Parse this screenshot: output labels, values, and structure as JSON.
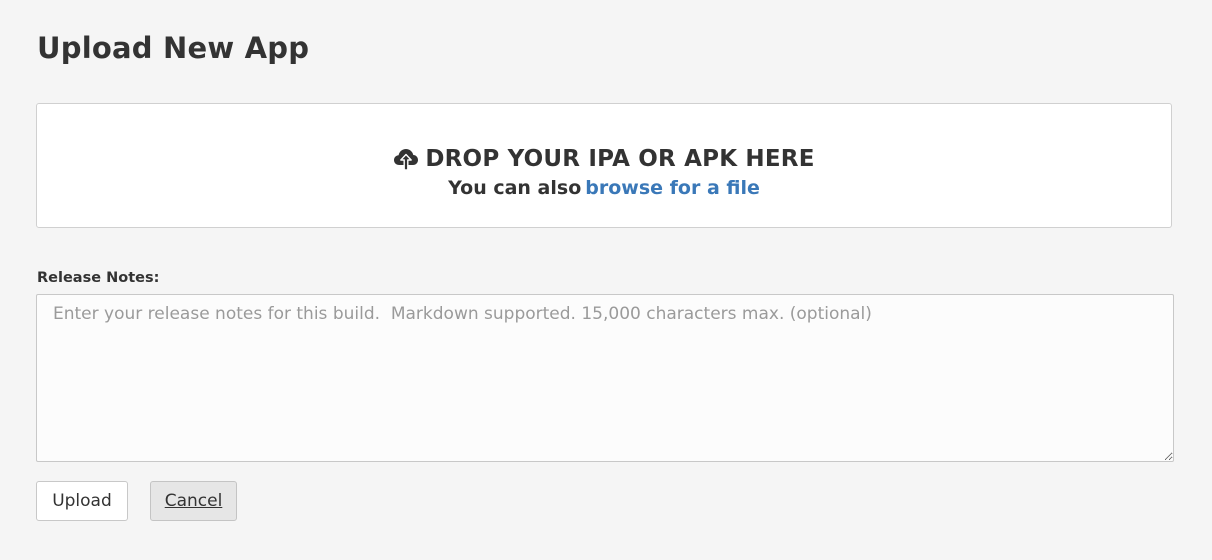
{
  "header": {
    "title": "Upload New App"
  },
  "dropzone": {
    "icon": "cloud-upload-icon",
    "heading": "DROP YOUR IPA OR APK HERE",
    "subtext_prefix": "You can also",
    "browse_link": "browse for a file"
  },
  "release_notes": {
    "label": "Release Notes:",
    "value": "",
    "placeholder": "Enter your release notes for this build.  Markdown supported. 15,000 characters max. (optional)"
  },
  "actions": {
    "upload_label": "Upload",
    "cancel_label": "Cancel"
  },
  "colors": {
    "background": "#f5f5f5",
    "link": "#3a78b8",
    "text": "#333333",
    "cancel_background": "#e6e6e6"
  }
}
